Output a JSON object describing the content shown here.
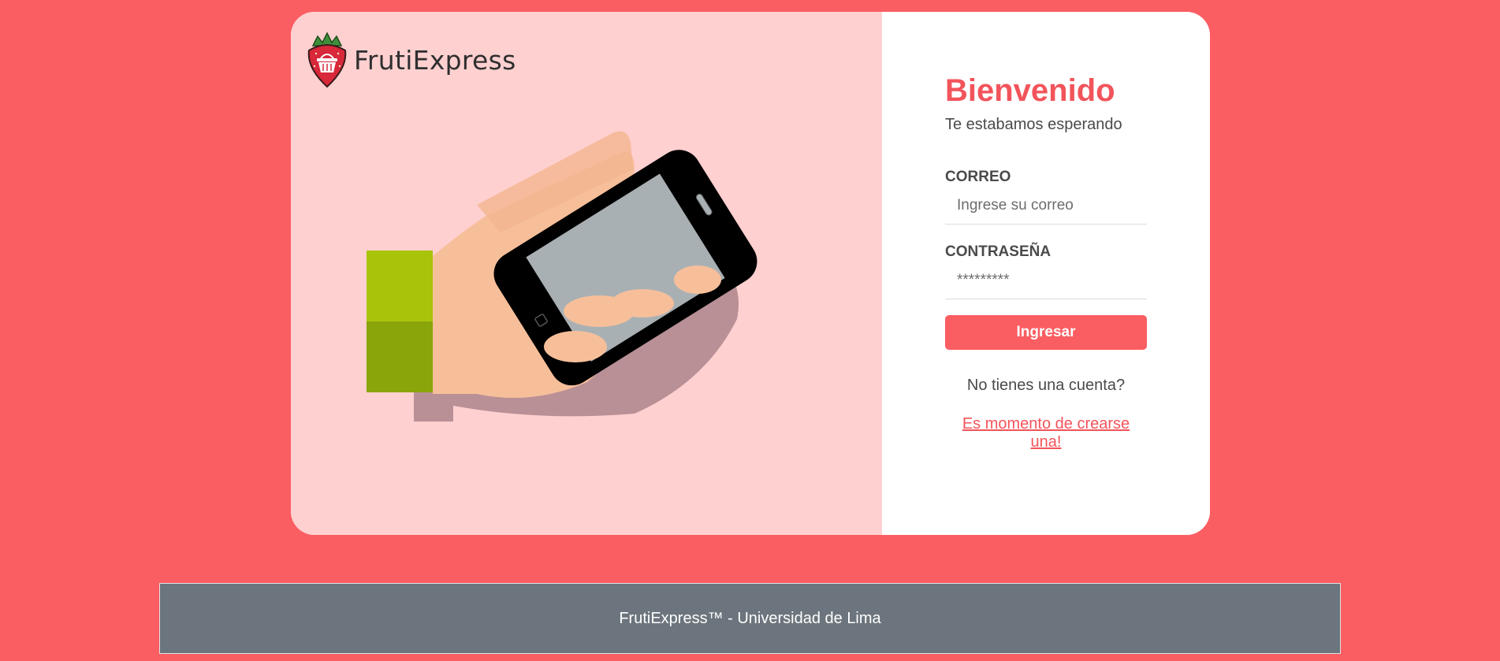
{
  "brand": {
    "name": "FrutiExpress"
  },
  "login": {
    "title": "Bienvenido",
    "subtitle": "Te estabamos esperando",
    "email_label": "CORREO",
    "email_placeholder": "Ingrese su correo",
    "password_label": "CONTRASEÑA",
    "password_placeholder": "*********",
    "submit_label": "Ingresar",
    "no_account_text": "No tienes una cuenta?",
    "signup_link": "Es momento de crearse una!"
  },
  "footer": {
    "text": "FrutiExpress™ - Universidad de Lima"
  },
  "colors": {
    "page_background": "#fa5e62",
    "left_panel": "#ffd0d0",
    "accent": "#f2545b",
    "footer_background": "#6c757d"
  },
  "icons": {
    "logo": "strawberry-basket-icon",
    "illustration": "hand-holding-phone-illustration"
  }
}
